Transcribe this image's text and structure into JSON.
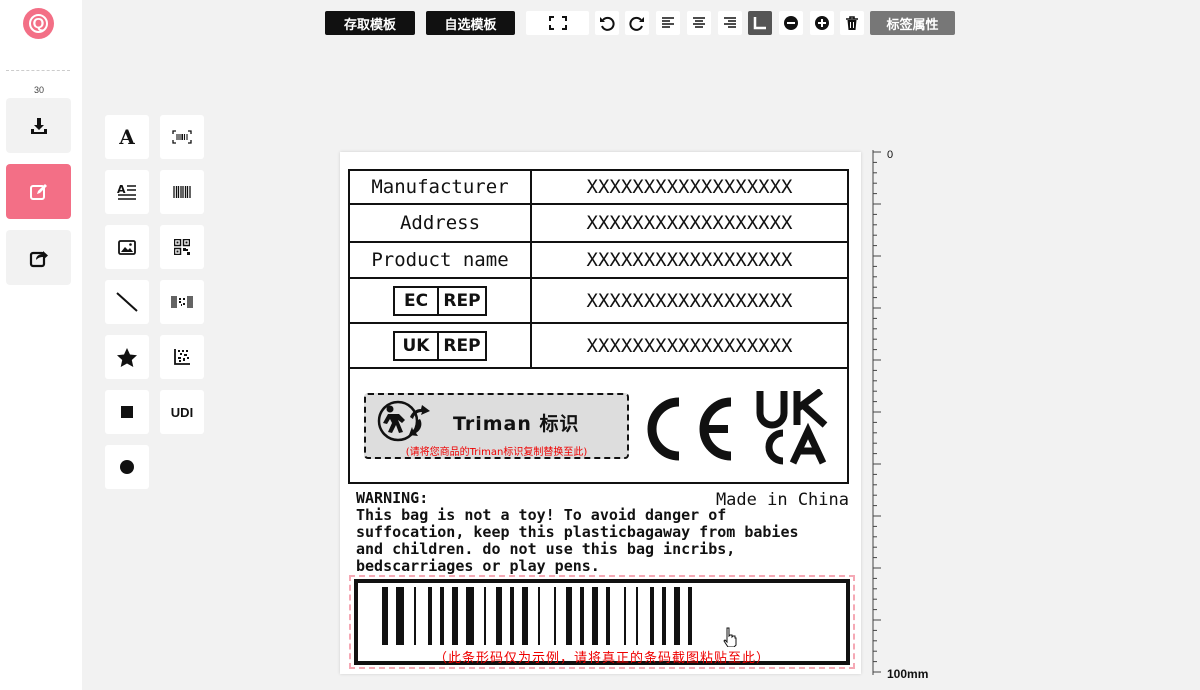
{
  "app": {
    "logo_letter": "Q",
    "accent_color": "#f36f86"
  },
  "rail": {
    "count_label": "30",
    "items": [
      {
        "name": "download",
        "icon": "download-tray-icon"
      },
      {
        "name": "edit",
        "icon": "edit-square-icon",
        "active": true
      },
      {
        "name": "share",
        "icon": "share-export-icon"
      }
    ]
  },
  "toolbar": {
    "save_template_label": "存取模板",
    "choose_template_label": "自选模板",
    "label_properties_label": "标签属性",
    "icons": [
      "fullscreen-icon",
      "undo-icon",
      "redo-icon",
      "align-left-icon",
      "align-center-icon",
      "align-right-icon",
      "snap-corner-icon",
      "zoom-out-icon",
      "zoom-in-icon",
      "delete-icon"
    ]
  },
  "tools": {
    "text_glyph": "A",
    "udi_label": "UDI",
    "items": [
      "text-tool",
      "barcode-scan-tool",
      "paragraph-tool",
      "barcode-tool",
      "image-tool",
      "qrcode-tool",
      "line-tool",
      "gs1-barcode-tool",
      "star-tool",
      "datamatrix-tool",
      "rectangle-tool",
      "udi-tool",
      "circle-tool"
    ]
  },
  "label": {
    "table": [
      {
        "key": "Manufacturer",
        "value": "XXXXXXXXXXXXXXXXXX"
      },
      {
        "key": "Address",
        "value": "XXXXXXXXXXXXXXXXXX"
      },
      {
        "key": "Product name",
        "value": "XXXXXXXXXXXXXXXXXX"
      },
      {
        "key_a": "EC",
        "key_b": "REP",
        "value": "XXXXXXXXXXXXXXXXXX"
      },
      {
        "key_a": "UK",
        "key_b": "REP",
        "value": "XXXXXXXXXXXXXXXXXX"
      }
    ],
    "triman_title": "Triman 标识",
    "triman_note": "(请将您商品的Triman标识复制替换至此)",
    "ce_mark": "CE",
    "ukca_line1": "UK",
    "ukca_line2": "CA",
    "warning_title": "WARNING:",
    "warning_lines": [
      "This bag is not a toy! To avoid danger of",
      "suffocation, keep this plasticbagaway from babies",
      "and children. do not use this bag incribs,",
      "bedscarriages or play pens."
    ],
    "made_in": "Made in China",
    "barcode_note": "（此条形码仅为示例，请将真正的条码截图粘贴至此）",
    "barcode_bars": [
      3,
      1,
      4,
      2,
      1,
      3,
      2,
      1,
      2,
      1,
      3,
      1,
      4,
      2,
      1,
      2,
      3,
      1,
      2,
      1,
      3,
      2,
      1,
      4,
      1,
      2,
      3,
      1,
      2,
      1,
      3,
      1,
      2,
      4,
      1,
      2,
      1,
      3,
      2,
      1,
      2,
      1,
      3,
      1,
      2
    ]
  },
  "ruler": {
    "top_label": "0",
    "bottom_label": "100mm"
  }
}
